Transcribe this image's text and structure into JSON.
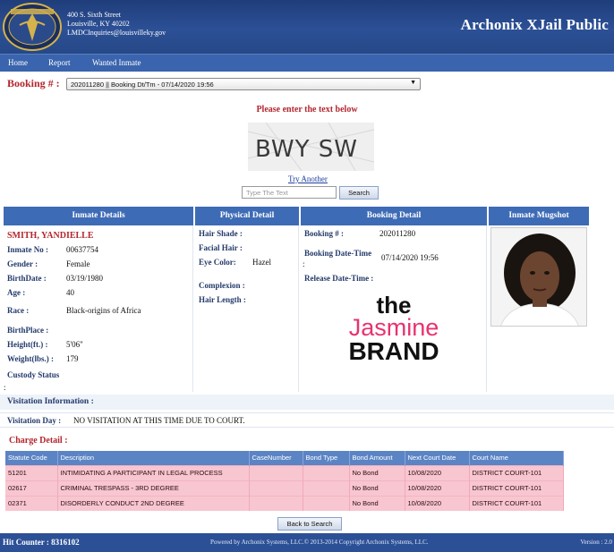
{
  "header": {
    "address_line1": "400 S. Sixth Street",
    "address_line2": "Louisville, KY 40202",
    "address_line3": "LMDCInquiries@louisvilleky.gov",
    "brand_title": "Archonix XJail Public",
    "logo_text_top": "LOUISVILLE",
    "logo_text_bottom": "METRO"
  },
  "nav": {
    "items": [
      "Home",
      "Report",
      "Wanted Inmate"
    ]
  },
  "booking": {
    "label": "Booking # :",
    "selected": "202011280 || Booking Dt/Tm - 07/14/2020 19:56"
  },
  "captcha": {
    "prompt": "Please enter the text below",
    "image_text": "BWY SW",
    "try_another": "Try Another",
    "input_placeholder": "Type The Text",
    "search_label": "Search"
  },
  "sections": {
    "inmate": "Inmate Details",
    "physical": "Physical Detail",
    "booking": "Booking Detail",
    "mugshot": "Inmate Mugshot"
  },
  "inmate": {
    "name": "SMITH, YANDIELLE",
    "inmate_no_label": "Inmate No :",
    "inmate_no": "00637754",
    "gender_label": "Gender :",
    "gender": "Female",
    "birthdate_label": "BirthDate :",
    "birthdate": "03/19/1980",
    "age_label": "Age :",
    "age": "40",
    "race_label": "Race :",
    "race": "Black-origins of Africa",
    "birthplace_label": "BirthPlace :",
    "height_label": "Height(ft.) :",
    "height": "5'06\"",
    "weight_label": "Weight(lbs.) :",
    "weight": "179",
    "custody_label": "Custody Status",
    "custody_value": ":"
  },
  "physical": {
    "hair_shade_label": "Hair Shade :",
    "facial_hair_label": "Facial Hair :",
    "eye_color_label": "Eye Color:",
    "eye_color": "Hazel",
    "complexion_label": "Complexion :",
    "hair_length_label": "Hair Length :"
  },
  "booking_detail": {
    "booking_no_label": "Booking # :",
    "booking_no": "202011280",
    "booking_dt_label": "Booking Date-Time",
    "booking_dt_colon": ":",
    "booking_dt": "07/14/2020 19:56",
    "release_label": "Release Date-Time :"
  },
  "watermark": {
    "line1": "the",
    "line2": "Jasmine",
    "line3": "BRAND"
  },
  "visitation": {
    "title": "Visitation Information :",
    "day_label": "Visitation Day :",
    "day_value": "NO VISITATION AT THIS TIME DUE TO COURT."
  },
  "charges": {
    "title": "Charge Detail :",
    "columns": [
      "Statute Code",
      "Description",
      "CaseNumber",
      "Bond Type",
      "Bond Amount",
      "Next Court Date",
      "Court Name"
    ],
    "rows": [
      [
        "51201",
        "INTIMIDATING A PARTICIPANT IN LEGAL PROCESS",
        "",
        "",
        "No Bond",
        "10/08/2020",
        "DISTRICT COURT-101"
      ],
      [
        "02617",
        "CRIMINAL TRESPASS - 3RD DEGREE",
        "",
        "",
        "No Bond",
        "10/08/2020",
        "DISTRICT COURT-101"
      ],
      [
        "02371",
        "DISORDERLY CONDUCT 2ND DEGREE",
        "",
        "",
        "No Bond",
        "10/08/2020",
        "DISTRICT COURT-101"
      ]
    ]
  },
  "back_label": "Back to Search",
  "footer": {
    "hit_counter": "Hit Counter : 8316102",
    "powered": "Powered by Archonix Systems, LLC.© 2013-2014 Copyright Archonix Systems, LLC.",
    "version": "Version : 2.0"
  },
  "colors": {
    "header_blue": "#2c5096",
    "nav_blue": "#3a64ad",
    "section_blue": "#3e6bb5",
    "accent_red": "#b3262e",
    "charge_row_pink": "#f8c6d0",
    "watermark_pink": "#e8326f"
  }
}
